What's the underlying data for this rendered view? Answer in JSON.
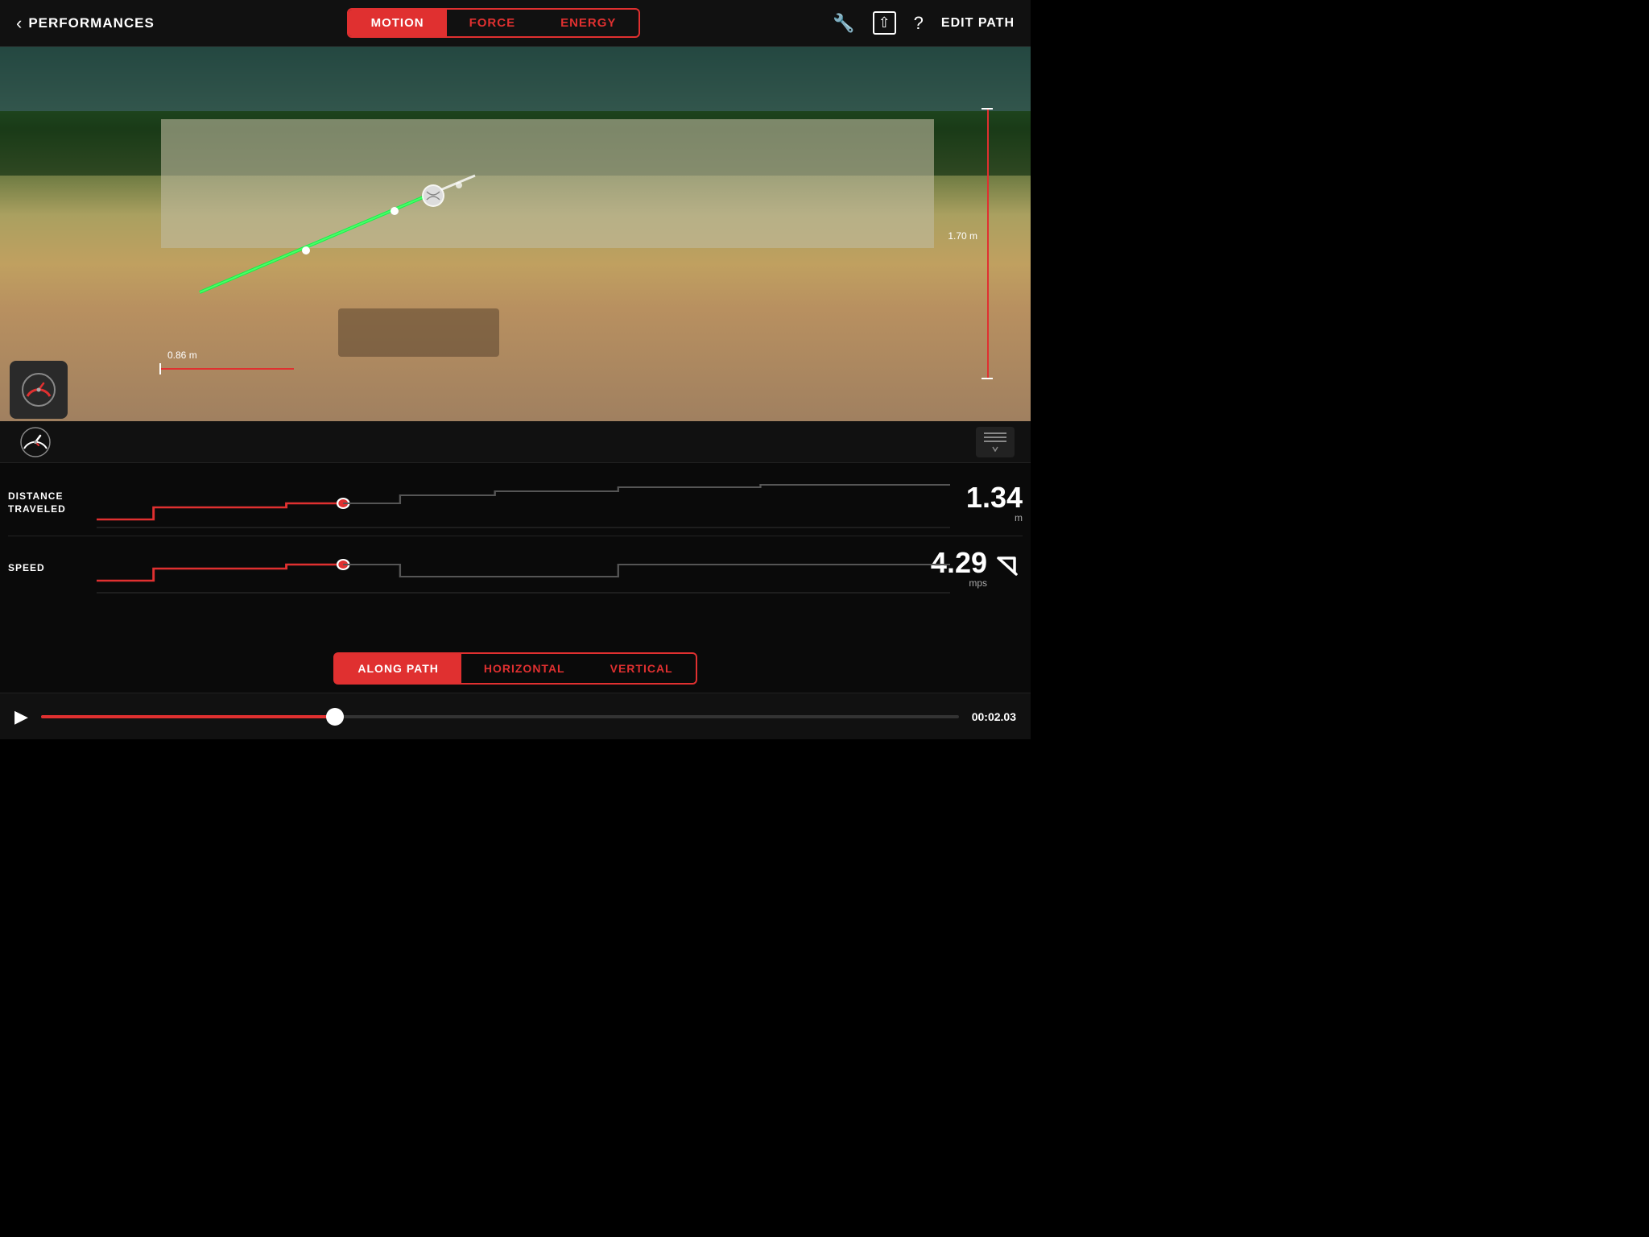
{
  "header": {
    "back_label": "PERFORMANCES",
    "tabs": [
      {
        "id": "motion",
        "label": "MOTION",
        "active": true
      },
      {
        "id": "force",
        "label": "FORCE",
        "active": false
      },
      {
        "id": "energy",
        "label": "ENERGY",
        "active": false
      }
    ],
    "edit_path_label": "EDIT PATH",
    "icons": {
      "wrench": "🔧",
      "share": "⬆",
      "help": "?"
    }
  },
  "video": {
    "measurement_left_value": "0.86 m",
    "measurement_right_value": "1.70 m"
  },
  "charts": {
    "distance_traveled": {
      "label_line1": "DISTANCE",
      "label_line2": "TRAVELED",
      "value": "1.34",
      "unit": "m"
    },
    "speed": {
      "label": "SPEED",
      "value": "4.29",
      "unit": "mps"
    }
  },
  "path_buttons": [
    {
      "id": "along-path",
      "label": "ALONG PATH",
      "active": true
    },
    {
      "id": "horizontal",
      "label": "HORIZONTAL",
      "active": false
    },
    {
      "id": "vertical",
      "label": "VERTICAL",
      "active": false
    }
  ],
  "playback": {
    "time": "00:02.03",
    "progress_percent": 32
  }
}
